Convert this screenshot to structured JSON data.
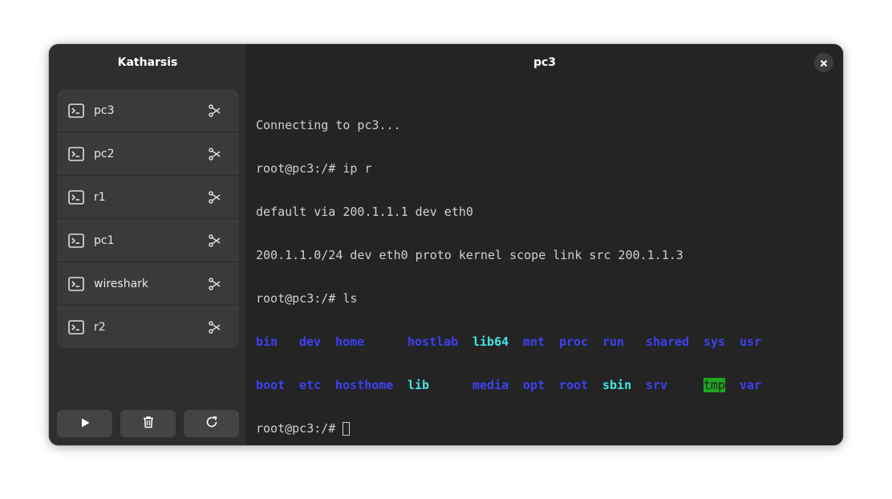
{
  "sidebar": {
    "title": "Katharsis",
    "devices": [
      {
        "label": "pc3"
      },
      {
        "label": "pc2"
      },
      {
        "label": "r1"
      },
      {
        "label": "pc1"
      },
      {
        "label": "wireshark"
      },
      {
        "label": "r2"
      }
    ],
    "buttons": [
      "play-icon",
      "trash-icon",
      "refresh-icon"
    ]
  },
  "main": {
    "title": "pc3"
  },
  "terminal": {
    "lines": [
      "Connecting to pc3...",
      "root@pc3:/# ip r",
      "default via 200.1.1.1 dev eth0",
      "200.1.1.0/24 dev eth0 proto kernel scope link src 200.1.1.3",
      "root@pc3:/# ls"
    ],
    "ls_row1": [
      "bin",
      "dev",
      "home",
      "hostlab",
      "lib64",
      "mnt",
      "proc",
      "run",
      "shared",
      "sys",
      "usr"
    ],
    "ls_row2": [
      "boot",
      "etc",
      "hosthome",
      "lib",
      "media",
      "opt",
      "root",
      "sbin",
      "srv",
      "tmp",
      "var"
    ],
    "prompt": "root@pc3:/# "
  },
  "colors": {
    "directory": "#3f3ff5",
    "symlink": "#45e5e5",
    "sticky_dir_bg": "#1ea51e"
  }
}
